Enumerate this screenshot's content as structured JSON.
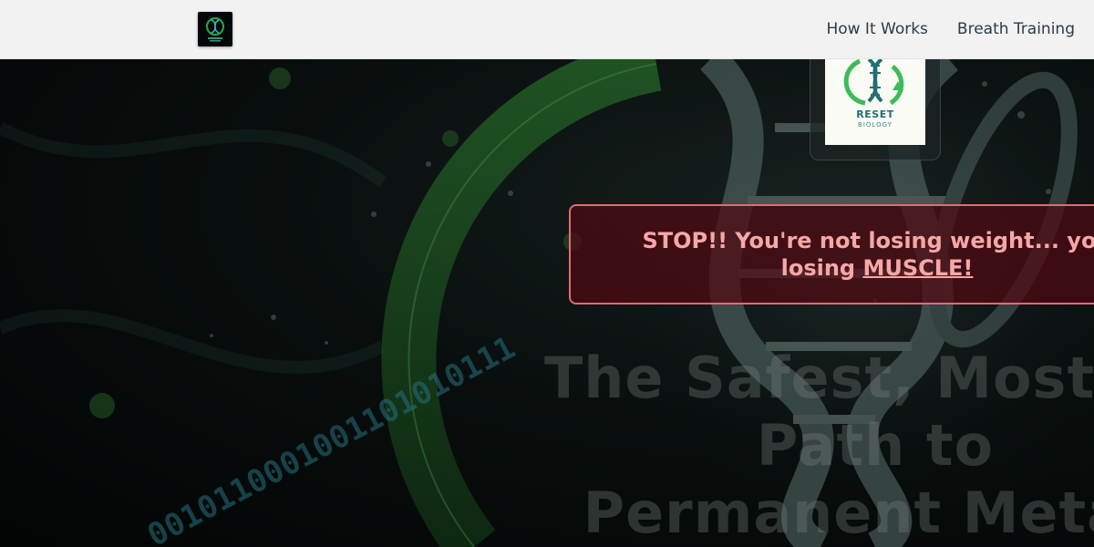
{
  "nav": {
    "links": [
      {
        "label": "How It Works"
      },
      {
        "label": "Breath Training"
      }
    ]
  },
  "badge": {
    "brand_line1": "RESET",
    "brand_line2": "BIOLOGY"
  },
  "alert": {
    "line1": "STOP!! You're not losing weight... you",
    "line2_prefix": "losing ",
    "line2_emphasis": "MUSCLE!"
  },
  "headline": {
    "line1": "The Safest, Most Eff",
    "line2": "Path to",
    "line3": "Permanent Metab"
  },
  "background": {
    "binary_text": "0010110001001101010111"
  },
  "colors": {
    "nav_bg": "#f2f2f2",
    "alert_border": "#e46a72",
    "alert_text": "#f6a7a7",
    "accent_green": "#2e8b3a"
  }
}
